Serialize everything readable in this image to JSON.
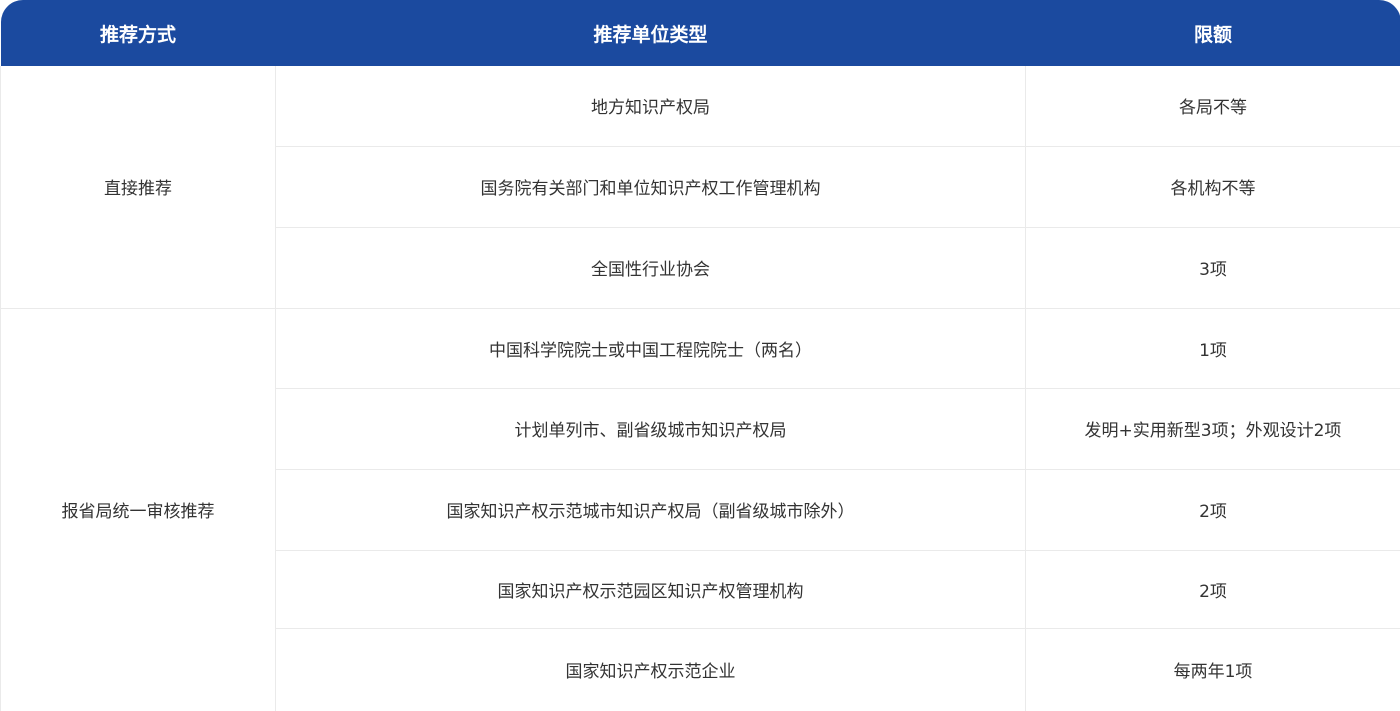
{
  "header": {
    "col1": "推荐方式",
    "col2": "推荐单位类型",
    "col3": "限额"
  },
  "groups": [
    {
      "method": "直接推荐",
      "rows": [
        {
          "type": "地方知识产权局",
          "quota": "各局不等"
        },
        {
          "type": "国务院有关部门和单位知识产权工作管理机构",
          "quota": "各机构不等"
        },
        {
          "type": "全国性行业协会",
          "quota": "3项"
        }
      ]
    },
    {
      "method": "报省局统一审核推荐",
      "rows": [
        {
          "type": "中国科学院院士或中国工程院院士（两名）",
          "quota": "1项"
        },
        {
          "type": "计划单列市、副省级城市知识产权局",
          "quota": "发明+实用新型3项；外观设计2项"
        },
        {
          "type": "国家知识产权示范城市知识产权局（副省级城市除外）",
          "quota": "2项"
        },
        {
          "type": "国家知识产权示范园区知识产权管理机构",
          "quota": "2项"
        },
        {
          "type": "国家知识产权示范企业",
          "quota": "每两年1项"
        }
      ]
    }
  ],
  "colors": {
    "header_bg": "#1b4a9f",
    "header_text": "#ffffff",
    "body_text": "#333333",
    "border": "#eaeaea"
  }
}
